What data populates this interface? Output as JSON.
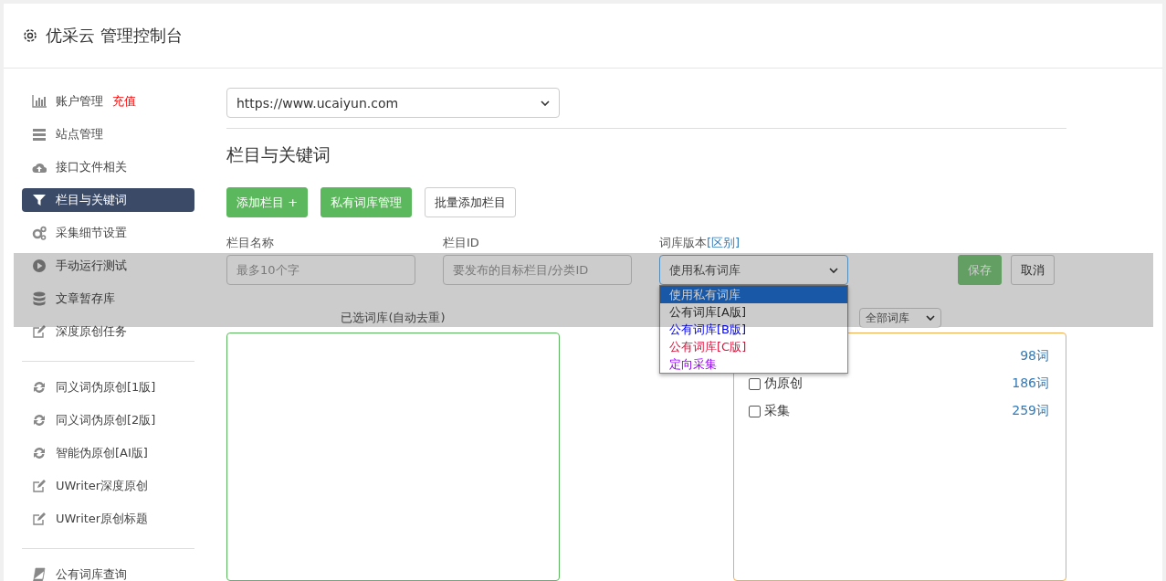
{
  "header": {
    "title": "优采云 管理控制台"
  },
  "sidebar": {
    "groups": [
      [
        {
          "label": "账户管理",
          "badge": "充值",
          "selected": false
        },
        {
          "label": "站点管理",
          "selected": false
        },
        {
          "label": "接口文件相关",
          "selected": false
        },
        {
          "label": "栏目与关键词",
          "selected": true
        },
        {
          "label": "采集细节设置",
          "selected": false
        },
        {
          "label": "手动运行测试",
          "selected": false
        },
        {
          "label": "文章暂存库",
          "selected": false
        },
        {
          "label": "深度原创任务",
          "selected": false
        }
      ],
      [
        {
          "label": "同义词伪原创[1版]",
          "selected": false
        },
        {
          "label": "同义词伪原创[2版]",
          "selected": false
        },
        {
          "label": "智能伪原创[AI版]",
          "selected": false
        },
        {
          "label": "UWriter深度原创",
          "selected": false
        },
        {
          "label": "UWriter原创标题",
          "selected": false
        }
      ],
      [
        {
          "label": "公有词库查询",
          "selected": false
        }
      ]
    ]
  },
  "site_select": {
    "value": "https://www.ucaiyun.com"
  },
  "heading": "栏目与关键词",
  "actions": [
    {
      "label": "添加栏目 +",
      "kind": "primary"
    },
    {
      "label": "私有词库管理",
      "kind": "primary"
    },
    {
      "label": "批量添加栏目",
      "kind": "default"
    }
  ],
  "form": {
    "name_label": "栏目名称",
    "name_placeholder": "最多10个字",
    "id_label": "栏目ID",
    "id_placeholder": "要发布的目标栏目/分类ID",
    "version_label": "词库版本",
    "version_link": "[区别]",
    "version_value": "使用私有词库",
    "options": [
      {
        "label": "使用私有词库",
        "selected": true
      },
      {
        "label": "公有词库[A版]",
        "selected": false,
        "color": "#333333"
      },
      {
        "label": "公有词库[B版]",
        "selected": false,
        "color": "#0000ff"
      },
      {
        "label": "公有词库[C版]",
        "selected": false,
        "color": "#dc143c"
      },
      {
        "label": "定向采集",
        "selected": false,
        "color": "#9900ff"
      }
    ],
    "save": "保存",
    "cancel": "取消"
  },
  "selected_panel": {
    "title": "已选词库(自动去重)"
  },
  "library_panel": {
    "filter": "全部词库",
    "rows": [
      {
        "count": "98词"
      },
      {
        "label": "伪原创",
        "count": "186词",
        "checked": false
      },
      {
        "label": "采集",
        "count": "259词",
        "checked": false
      }
    ]
  }
}
